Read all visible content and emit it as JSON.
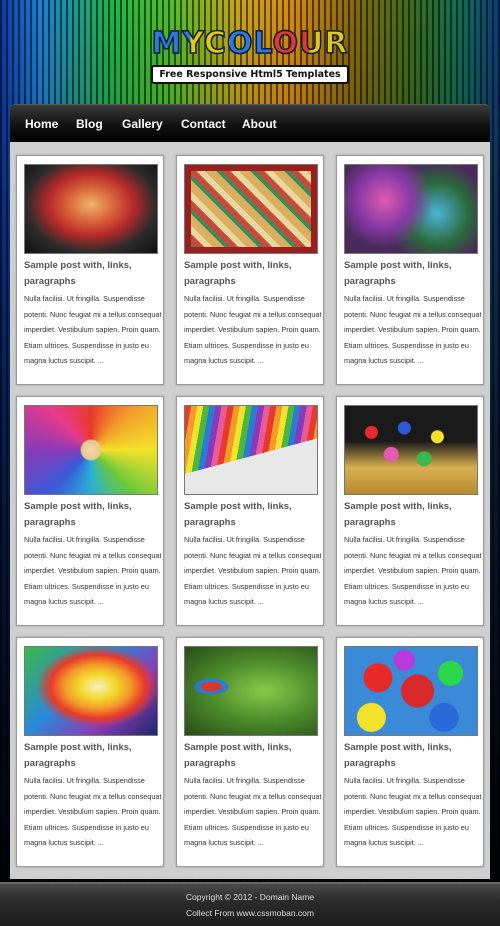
{
  "header": {
    "logo_text": "MYCOLOUR",
    "tagline": "Free Responsive Html5 Templates"
  },
  "nav": {
    "items": [
      {
        "label": "Home"
      },
      {
        "label": "Blog"
      },
      {
        "label": "Gallery"
      },
      {
        "label": "Contact"
      },
      {
        "label": "About"
      }
    ]
  },
  "posts": [
    {
      "title": "Sample post with, links, paragraphs",
      "image": "painted-child-face",
      "excerpt": "Nulla facilisi. Ut fringilla. Suspendisse potenti. Nunc feugiat mi a tellus consequat imperdiet. Vestibulum sapien. Proin quam. Etiam ultrices. Suspendisse in justo eu magna luctus suscipit. ..."
    },
    {
      "title": "Sample post with, links, paragraphs",
      "image": "letter-blocks-tray",
      "excerpt": "Nulla facilisi. Ut fringilla. Suspendisse potenti. Nunc feugiat mi a tellus consequat imperdiet. Vestibulum sapien. Proin quam. Etiam ultrices. Suspendisse in justo eu magna luctus suscipit. ..."
    },
    {
      "title": "Sample post with, links, paragraphs",
      "image": "colour-festival-crowd",
      "excerpt": "Nulla facilisi. Ut fringilla. Suspendisse potenti. Nunc feugiat mi a tellus consequat imperdiet. Vestibulum sapien. Proin quam. Etiam ultrices. Suspendisse in justo eu magna luctus suscipit. ..."
    },
    {
      "title": "Sample post with, links, paragraphs",
      "image": "coloured-pencils-circle",
      "excerpt": "Nulla facilisi. Ut fringilla. Suspendisse potenti. Nunc feugiat mi a tellus consequat imperdiet. Vestibulum sapien. Proin quam. Etiam ultrices. Suspendisse in justo eu magna luctus suscipit. ..."
    },
    {
      "title": "Sample post with, links, paragraphs",
      "image": "crayons-box",
      "excerpt": "Nulla facilisi. Ut fringilla. Suspendisse potenti. Nunc feugiat mi a tellus consequat imperdiet. Vestibulum sapien. Proin quam. Etiam ultrices. Suspendisse in justo eu magna luctus suscipit. ..."
    },
    {
      "title": "Sample post with, links, paragraphs",
      "image": "flower-basket",
      "excerpt": "Nulla facilisi. Ut fringilla. Suspendisse potenti. Nunc feugiat mi a tellus consequat imperdiet. Vestibulum sapien. Proin quam. Etiam ultrices. Suspendisse in justo eu magna luctus suscipit. ..."
    },
    {
      "title": "Sample post with, links, paragraphs",
      "image": "rainbow-swirl",
      "excerpt": "Nulla facilisi. Ut fringilla. Suspendisse potenti. Nunc feugiat mi a tellus consequat imperdiet. Vestibulum sapien. Proin quam. Etiam ultrices. Suspendisse in justo eu magna luctus suscipit. ..."
    },
    {
      "title": "Sample post with, links, paragraphs",
      "image": "parrot-on-green",
      "excerpt": "Nulla facilisi. Ut fringilla. Suspendisse potenti. Nunc feugiat mi a tellus consequat imperdiet. Vestibulum sapien. Proin quam. Etiam ultrices. Suspendisse in justo eu magna luctus suscipit. ..."
    },
    {
      "title": "Sample post with, links, paragraphs",
      "image": "coloured-balls",
      "excerpt": "Nulla facilisi. Ut fringilla. Suspendisse potenti. Nunc feugiat mi a tellus consequat imperdiet. Vestibulum sapien. Proin quam. Etiam ultrices. Suspendisse in justo eu magna luctus suscipit. ..."
    }
  ],
  "footer": {
    "copyright": "Copyright © 2012 - Domain Name",
    "credit": "Collect From www.cssmoban.com"
  },
  "colors": {
    "nav_bg": "#111111",
    "panel_bg": "#cfcfcf",
    "card_title": "#555555",
    "footer_bg": "#2b2b2b"
  }
}
